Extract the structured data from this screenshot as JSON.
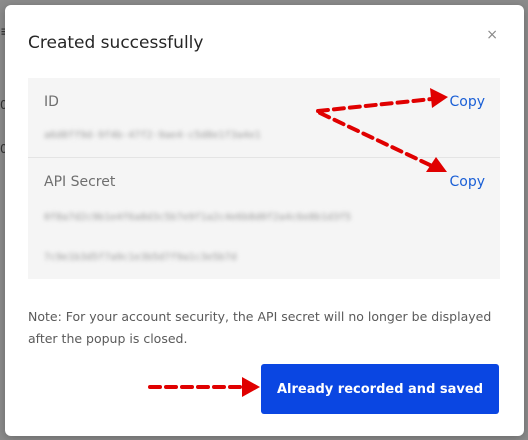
{
  "background": {
    "fragments": [
      "≡",
      "0",
      "0"
    ]
  },
  "dialog": {
    "title": "Created successfully",
    "close_icon": "×",
    "id_section": {
      "label": "ID",
      "copy_label": "Copy",
      "value": "a6d8ff9d-9f4b-47f2-9ae4-c5d8e1f3a4e1"
    },
    "secret_section": {
      "label": "API Secret",
      "copy_label": "Copy",
      "value_line1": "0f8a7d2c9b1e4f6a8d3c5b7e9f1a2c4e6b8d0f2a4c6e8b1d3f5",
      "value_line2": "7c9e1b3d5f7a9c1e3b5d7f9a1c3e5b7d"
    },
    "note": "Note: For your account security, the API secret will no longer be displayed after the popup is closed.",
    "confirm_button": "Already recorded and saved"
  },
  "colors": {
    "accent": "#0a46e2",
    "link": "#1a5fd6",
    "annotation_arrow": "#e00000"
  }
}
